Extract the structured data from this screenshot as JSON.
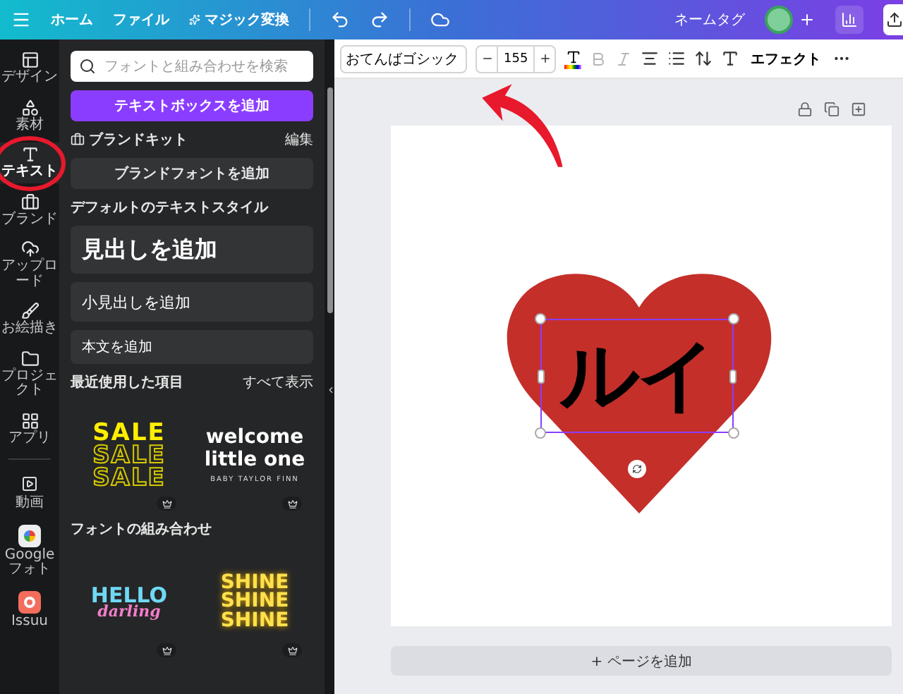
{
  "topbar": {
    "menu": [
      "ホーム",
      "ファイル",
      "マジック変換"
    ],
    "design_name": "ネームタグ"
  },
  "rail": {
    "items": [
      {
        "label": "デザイン",
        "selected": false
      },
      {
        "label": "素材",
        "selected": false
      },
      {
        "label": "テキスト",
        "selected": true
      },
      {
        "label": "ブランド",
        "selected": false
      },
      {
        "label": "アップロード",
        "selected": false
      },
      {
        "label": "お絵描き",
        "selected": false
      },
      {
        "label": "プロジェクト",
        "selected": false
      },
      {
        "label": "アプリ",
        "selected": false
      }
    ],
    "apps": [
      {
        "label": "動画"
      },
      {
        "label": "Googleフォト"
      },
      {
        "label": "Issuu"
      }
    ]
  },
  "panel": {
    "search": {
      "placeholder": "フォントと組み合わせを検索"
    },
    "add_textbox": "テキストボックスを追加",
    "brand_kit": {
      "title": "ブランドキット",
      "action": "編集",
      "button": "ブランドフォントを追加"
    },
    "default_styles": {
      "title": "デフォルトのテキストスタイル",
      "items": [
        {
          "kind": "heading",
          "label": "見出しを追加"
        },
        {
          "kind": "subheading",
          "label": "小見出しを追加"
        },
        {
          "kind": "body",
          "label": "本文を追加"
        }
      ]
    },
    "recent": {
      "title": "最近使用した項目",
      "action": "すべて表示",
      "templates": [
        {
          "kind": "sale",
          "lines": [
            "SALE",
            "SALE",
            "SALE"
          ],
          "premium": true
        },
        {
          "kind": "welcome",
          "lines": [
            "welcome",
            "little one"
          ],
          "subtitle": "BABY TAYLOR FINN",
          "premium": true
        }
      ]
    },
    "combos": {
      "title": "フォントの組み合わせ",
      "templates": [
        {
          "kind": "hello",
          "lines": [
            "HELLO",
            "darling"
          ],
          "premium": true
        },
        {
          "kind": "shine",
          "lines": [
            "SHINE",
            "SHINE",
            "SHINE"
          ],
          "premium": true
        }
      ]
    }
  },
  "toolbar": {
    "font": "おてんばゴシック",
    "size": "155",
    "effects": "エフェクト"
  },
  "canvas": {
    "text": "ルイ",
    "selected": true,
    "add_page": "+ ページを追加"
  }
}
